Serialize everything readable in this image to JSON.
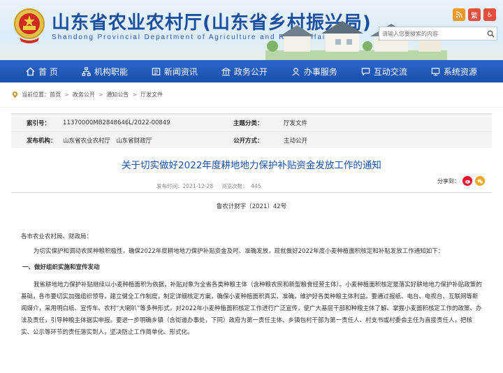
{
  "header": {
    "title": "山东省农业农村厅(山东省乡村振兴局)",
    "subtitle": "Shandong Provincial Department of Agriculture and Rural Affairs",
    "tools": [
      {
        "icon": "rss-icon",
        "color": "#f39a1e",
        "label": ""
      },
      {
        "icon": "traditional-chinese-icon",
        "color": "#e84e3c",
        "label": "繁"
      },
      {
        "icon": "accessibility-icon",
        "color": "#e84e3c",
        "label": "♿"
      }
    ],
    "search_placeholder": "请输入您要搜索的内容"
  },
  "nav": {
    "items": [
      {
        "label": "首 页",
        "icon": "home-icon"
      },
      {
        "label": "机构职能",
        "icon": "org-icon"
      },
      {
        "label": "新闻资讯",
        "icon": "news-icon"
      },
      {
        "label": "政务公开",
        "icon": "gov-icon"
      },
      {
        "label": "办事服务",
        "icon": "service-icon"
      },
      {
        "label": "互动交流",
        "icon": "chat-icon"
      },
      {
        "label": "系统资源",
        "icon": "system-icon"
      }
    ]
  },
  "breadcrumb": {
    "prefix": "当前位置：",
    "items": [
      "首页",
      "政务公开",
      "通知公告",
      "厅发文件"
    ]
  },
  "meta": {
    "index_label": "索引号：",
    "index_value": "11370000MB2848646L/2022-00849",
    "topic_label": "主题分类：",
    "topic_value": "厅发文件",
    "org_label": "发布机构：",
    "org_value": "山东省农业农村厅   山东省财政厅",
    "open_label": "公开方式：",
    "open_value": "主动公开"
  },
  "article": {
    "title": "关于切实做好2022年度耕地地力保护补贴资金发放工作的通知",
    "info": "发布时间：2021-12-28     浏览次数：  445",
    "share_label": "分享到：",
    "doc_no": "鲁农计财字〔2021〕42号",
    "salutation": "各市农业农村局、财政局：",
    "intro": "为切实保护和调动农民种粮积极性，确保2022年度耕地地力保护补贴资金及时、准确发放，现就做好2022年度小麦种植面积核定和补贴发放工作通知如下：",
    "section1": "一、做好组织实施和宣传发动",
    "para1": "我省耕地地力保护补贴继续以小麦种植面积为依据，补贴对象为全省各类种粮主体（含种粮农民和新型粮食经营主体）。小麦种植面积核定是落实好耕地地力保护补贴政策的基础，各市要切实加强组织领导，建立健全工作制度，制定详细核定方案，确保小麦种植面积真实、准确，维护好各类种粮主体利益。要通过报纸、电台、电视台、互联网等新闻媒介，采用明白纸、宣传车、农村“大喇叭”等多种形式，对2022年小麦种植面积核定工作进行广泛宣传，使广大基层干部和种粮主体了解、掌握小麦面积核定工作的政策、办法及责任，引导种粮主体据实申报。要进一步明确乡镇（含街道办事处，下同）政府为第一责任主体、乡镇包村干部为第一责任人、村支书或村委会主任为直接责任人，把核实、公示等环节的责任落实到人，坚决防止工作简单化、形式化。"
  },
  "colors": {
    "nav_blue": "#1a4fae",
    "title_blue": "#1a4fae",
    "weibo_red": "#e6162d",
    "wechat_orange": "#f5a623"
  }
}
